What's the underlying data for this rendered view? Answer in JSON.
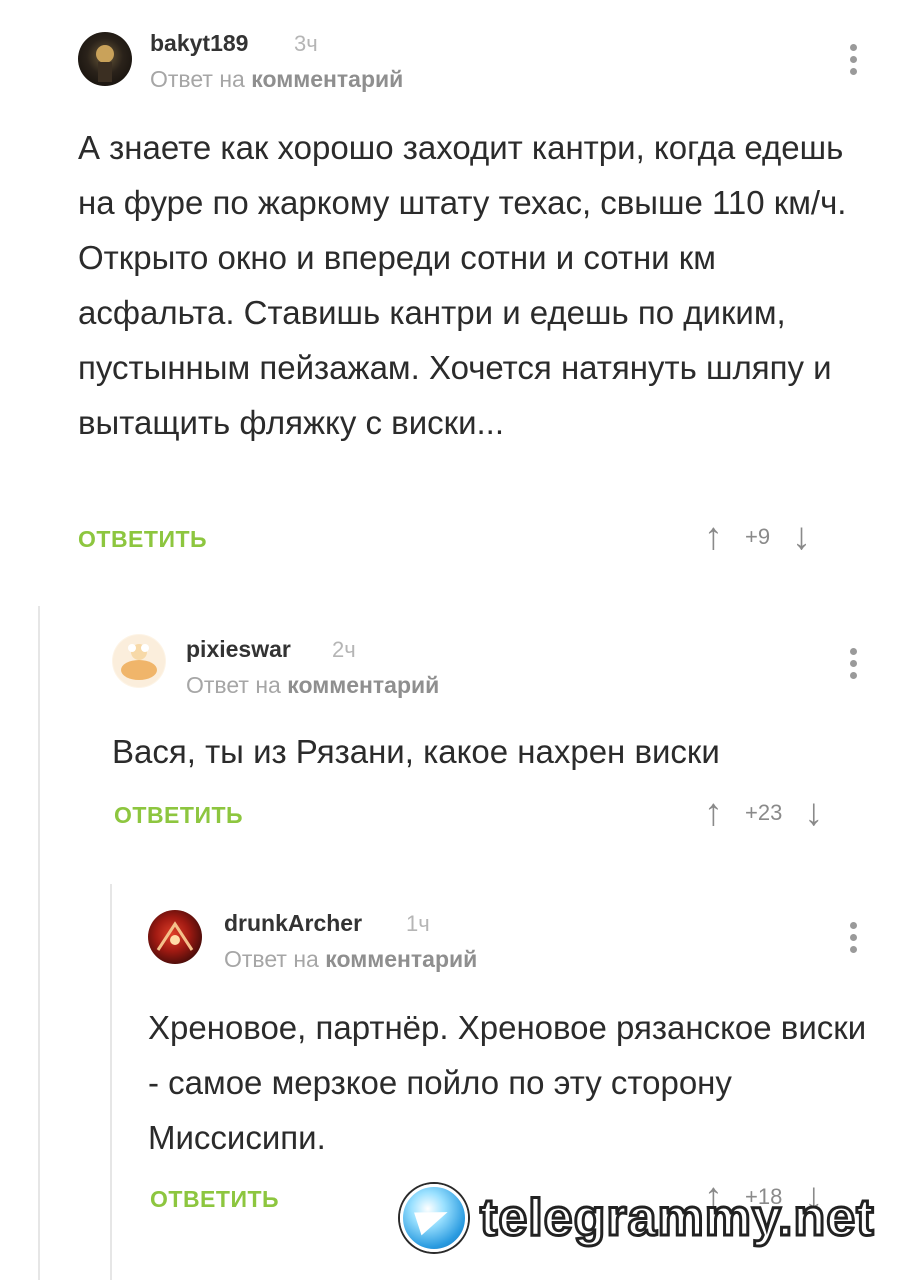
{
  "comments": [
    {
      "username": "bakyt189",
      "time": "3ч",
      "reply_prefix": "Ответ на",
      "reply_target": "комментарий",
      "text": "А знаете как хорошо заходит кантри, когда едешь на фуре по жаркому штату техас, свыше 110 км/ч. Открыто окно и впереди сотни и сотни км асфальта. Ставишь кантри и едешь по диким, пустынным пейзажам. Хочется натянуть шляпу и вытащить фляжку с виски...",
      "reply_label": "ОТВЕТИТЬ",
      "score": "+9"
    },
    {
      "username": "pixieswar",
      "time": "2ч",
      "reply_prefix": "Ответ на",
      "reply_target": "комментарий",
      "text": "Вася, ты из Рязани, какое нахрен виски",
      "reply_label": "ОТВЕТИТЬ",
      "score": "+23"
    },
    {
      "username": "drunkArcher",
      "time": "1ч",
      "reply_prefix": "Ответ на",
      "reply_target": "комментарий",
      "text": "Хреновое, партнёр. Хреновое рязанское виски - самое мерзкое пойло по эту сторону Миссисипи.",
      "reply_label": "ОТВЕТИТЬ",
      "score": "+18"
    }
  ],
  "icons": {
    "upvote": "↑",
    "downvote": "↓"
  },
  "watermark": {
    "text": "telegrammy.net"
  },
  "colors": {
    "accent": "#8dc63f",
    "muted": "#a6a6a6"
  }
}
